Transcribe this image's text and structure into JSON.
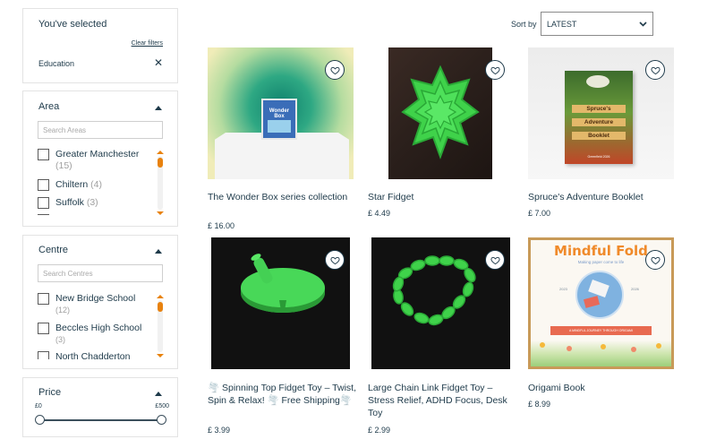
{
  "filters": {
    "selected": {
      "heading": "You've selected",
      "clear_label": "Clear filters",
      "chip": "Education",
      "chip_remove": "✕"
    },
    "area": {
      "heading": "Area",
      "search_placeholder": "Search Areas",
      "options": [
        {
          "label": "Greater Manchester",
          "count": "(15)"
        },
        {
          "label": "Chiltern",
          "count": "(4)"
        },
        {
          "label": "Suffolk",
          "count": "(3)"
        }
      ]
    },
    "centre": {
      "heading": "Centre",
      "search_placeholder": "Search Centres",
      "options": [
        {
          "label": "New Bridge School",
          "count": "(12)"
        },
        {
          "label": "Beccles High School",
          "count": "(3)"
        },
        {
          "label": "North Chadderton",
          "count": ""
        }
      ]
    },
    "price": {
      "heading": "Price",
      "min_label": "£0",
      "max_label": "£500"
    }
  },
  "sort": {
    "label": "Sort by",
    "value": "LATEST"
  },
  "products": [
    {
      "title": "The Wonder Box series collection",
      "price": "£ 16.00"
    },
    {
      "title": "Star Fidget",
      "price": "£ 4.49"
    },
    {
      "title": "Spruce's Adventure Booklet",
      "price": "£ 7.00"
    },
    {
      "title": "🌪️ Spinning Top Fidget Toy – Twist, Spin & Relax! 🌪️ Free Shipping🌪️",
      "price": "£ 3.99"
    },
    {
      "title": "Large Chain Link Fidget Toy – Stress Relief, ADHD Focus, Desk Toy",
      "price": "£ 2.99"
    },
    {
      "title": "Origami Book",
      "price": "£ 8.99"
    }
  ],
  "product_images": {
    "booklet": {
      "badge": "Spruce's",
      "line2": "Adventure",
      "line3": "Booklet",
      "footer": "Greenfield 2026"
    },
    "origami": {
      "title": "Mindful Fold",
      "subtitle": "Making paper come to life",
      "ribbon": "A MINDFUL JOURNEY THROUGH ORIGAMI",
      "left_tag": "2023",
      "right_tag": "2026"
    },
    "wonder": {
      "text": "Wonder Box"
    }
  },
  "icons": {
    "favorite": "heart-outline-icon",
    "collapse": "chevron-up-icon",
    "sort": "chevron-down-icon"
  },
  "colors": {
    "text": "#1e3a4a",
    "accent": "#e8820e",
    "border": "#e3e3e3"
  }
}
